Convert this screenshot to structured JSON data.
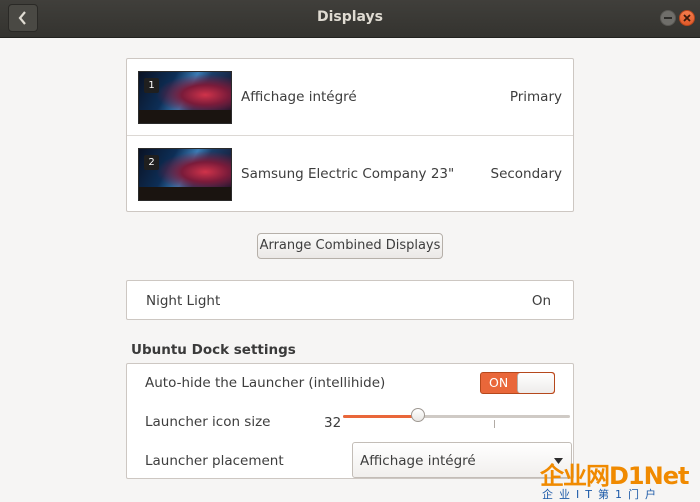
{
  "window": {
    "title": "Displays",
    "back_icon": "chevron-left-icon",
    "minimize_icon": "minimize-icon",
    "close_icon": "close-icon"
  },
  "displays": [
    {
      "number": "1",
      "name": "Affichage intégré",
      "role": "Primary"
    },
    {
      "number": "2",
      "name": "Samsung Electric Company 23\"",
      "role": "Secondary"
    }
  ],
  "arrange_button": "Arrange Combined Displays",
  "night_light": {
    "label": "Night Light",
    "value": "On"
  },
  "dock": {
    "section_title": "Ubuntu Dock settings",
    "autohide_label": "Auto-hide the Launcher (intellihide)",
    "autohide_toggle": "ON",
    "icon_size_label": "Launcher icon size",
    "icon_size_value": "32",
    "icon_size_fraction": 0.33,
    "placement_label": "Launcher placement",
    "placement_value": "Affichage intégré"
  },
  "watermark": {
    "line1": "企业网D1Net",
    "line2": "企业IT第1门户"
  },
  "colors": {
    "accent": "#e9673a",
    "titlebar": "#3a3935",
    "background": "#f6f5f4"
  }
}
